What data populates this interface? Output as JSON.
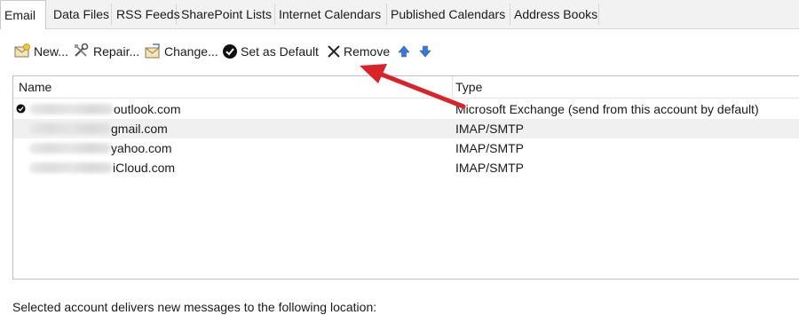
{
  "tabs": [
    {
      "label": "Email"
    },
    {
      "label": "Data Files"
    },
    {
      "label": "RSS Feeds"
    },
    {
      "label": "SharePoint Lists"
    },
    {
      "label": "Internet Calendars"
    },
    {
      "label": "Published Calendars"
    },
    {
      "label": "Address Books"
    }
  ],
  "toolbar": {
    "new_label": "New...",
    "repair_label": "Repair...",
    "change_label": "Change...",
    "default_label": "Set as Default",
    "remove_label": "Remove"
  },
  "list": {
    "columns": {
      "name": "Name",
      "type": "Type"
    },
    "rows": [
      {
        "name": "outlook.com",
        "type": "Microsoft Exchange (send from this account by default)",
        "default": true
      },
      {
        "name": "gmail.com",
        "type": "IMAP/SMTP"
      },
      {
        "name": "yahoo.com",
        "type": "IMAP/SMTP"
      },
      {
        "name": "iCloud.com",
        "type": "IMAP/SMTP"
      }
    ]
  },
  "footer": {
    "text": "Selected account delivers new messages to the following location:"
  },
  "colors": {
    "arrow": "#d9232a",
    "up_down_arrows": "#3c78d8",
    "tab_bar": "#f2f2f2"
  },
  "icons": [
    "new-account-icon",
    "repair-icon",
    "change-icon",
    "set-default-icon",
    "remove-icon",
    "move-up-icon",
    "move-down-icon",
    "default-check-icon"
  ]
}
